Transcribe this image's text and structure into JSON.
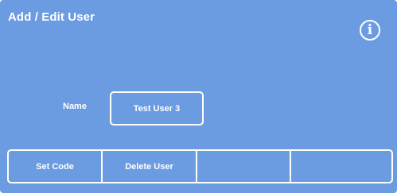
{
  "window": {
    "title": "Add / Edit User"
  },
  "header": {
    "info_icon": "info-icon",
    "info_glyph": "i"
  },
  "form": {
    "name_label": "Name",
    "name_value": "Test User 3"
  },
  "toolbar": {
    "buttons": [
      {
        "label": "Set Code"
      },
      {
        "label": "Delete User"
      },
      {
        "label": ""
      },
      {
        "label": ""
      }
    ]
  },
  "colors": {
    "background": "#6b9be0",
    "foreground": "#ffffff"
  }
}
